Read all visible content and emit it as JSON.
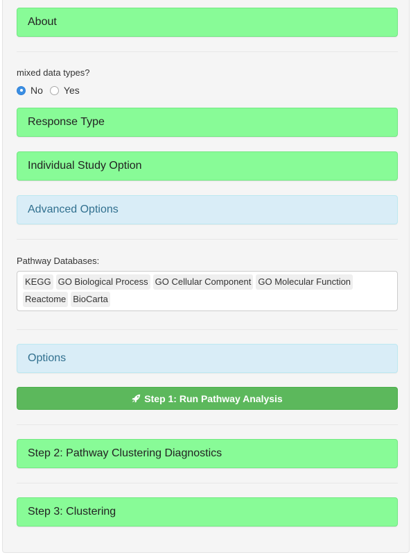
{
  "panels": {
    "about": "About",
    "response_type": "Response Type",
    "individual_study": "Individual Study Option",
    "advanced_options": "Advanced Options",
    "options": "Options",
    "step2": "Step 2: Pathway Clustering Diagnostics",
    "step3": "Step 3: Clustering"
  },
  "mixed_data": {
    "label": "mixed data types?",
    "options": [
      "No",
      "Yes"
    ],
    "selected": "No"
  },
  "pathway": {
    "label": "Pathway Databases:",
    "selected": [
      "KEGG",
      "GO Biological Process",
      "GO Cellular Component",
      "GO Molecular Function",
      "Reactome",
      "BioCarta"
    ]
  },
  "run_button": {
    "label": "Step 1: Run Pathway Analysis",
    "icon": "rocket-icon"
  },
  "colors": {
    "green_panel": "#88fb97",
    "blue_panel": "#d9edf7",
    "run_button": "#5cb85c",
    "radio_checked": "#3b8fe3"
  }
}
